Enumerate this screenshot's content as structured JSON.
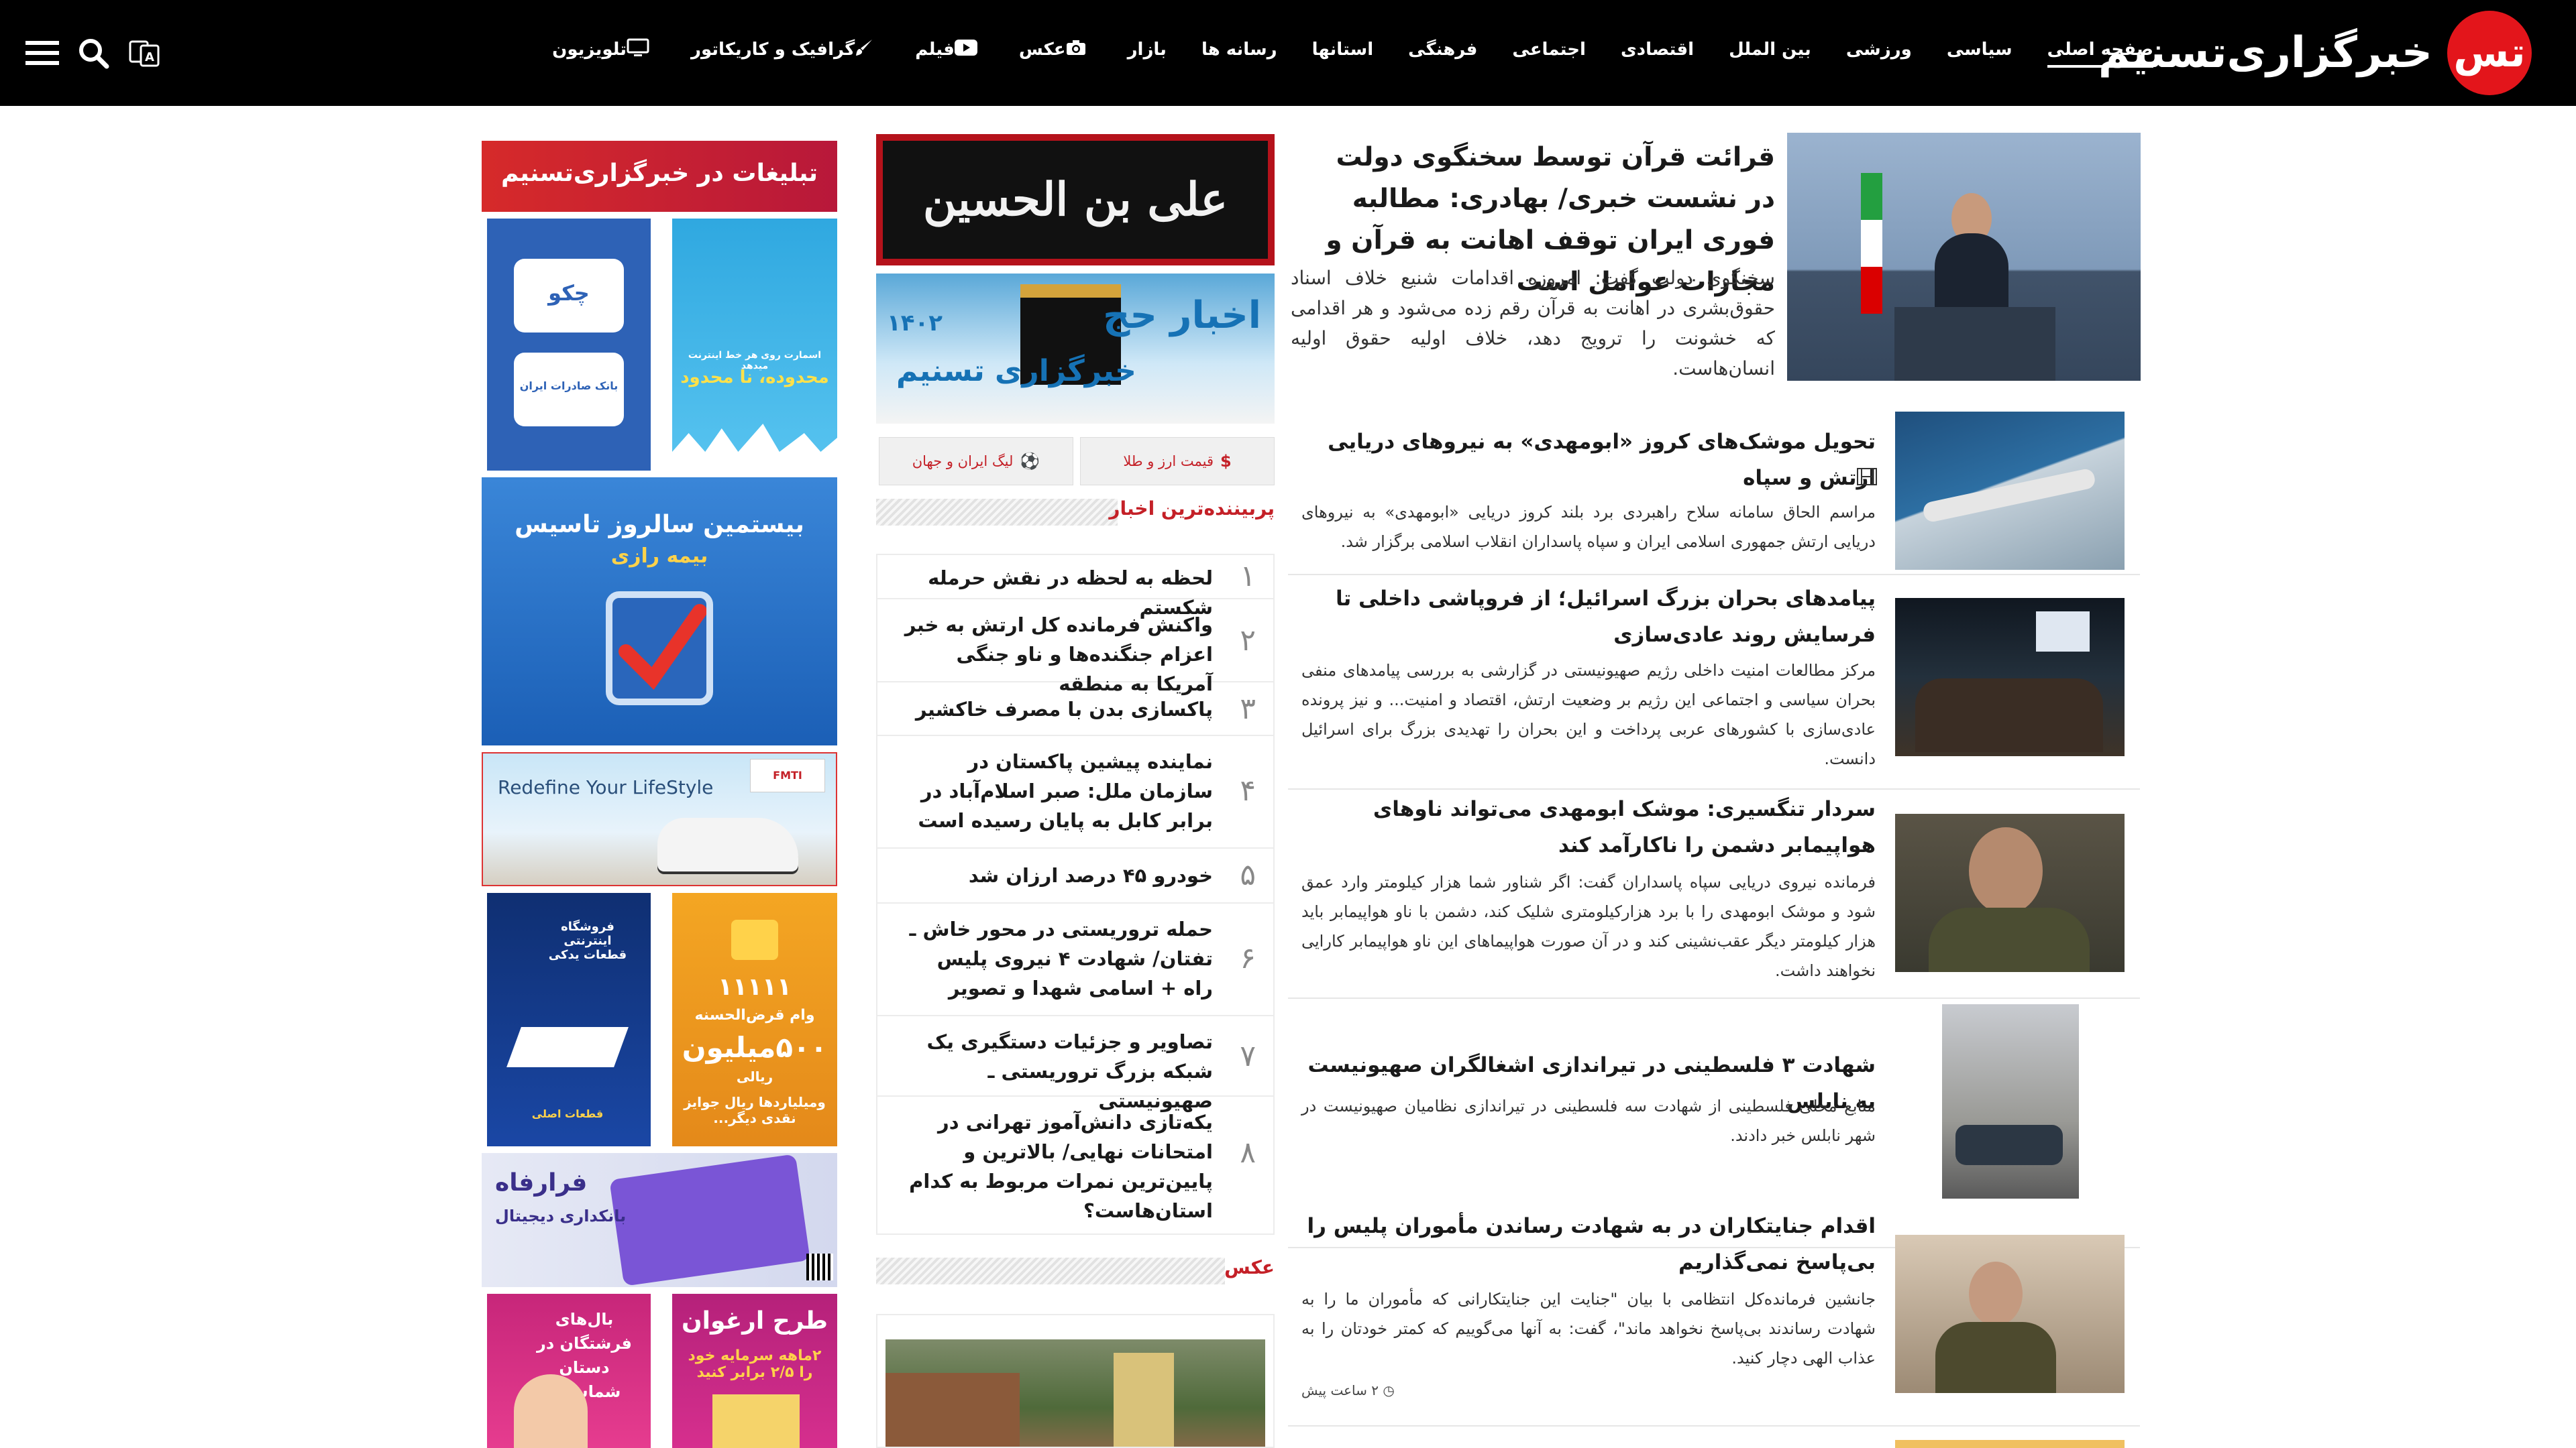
{
  "header": {
    "logo_text": "خبرگزاری‌تسنیم",
    "logo_mark": "تس",
    "nav": [
      {
        "label": "صفحه اصلی",
        "icon": "",
        "active": true
      },
      {
        "label": "سیاسی",
        "icon": ""
      },
      {
        "label": "ورزشی",
        "icon": ""
      },
      {
        "label": "بین الملل",
        "icon": ""
      },
      {
        "label": "اقتصادی",
        "icon": ""
      },
      {
        "label": "اجتماعی",
        "icon": ""
      },
      {
        "label": "فرهنگی",
        "icon": ""
      },
      {
        "label": "استانها",
        "icon": ""
      },
      {
        "label": "رسانه ها",
        "icon": ""
      },
      {
        "label": "بازار",
        "icon": ""
      },
      {
        "label": "عکس",
        "icon": "camera-icon"
      },
      {
        "label": "فیلم",
        "icon": "play-icon"
      },
      {
        "label": "گرافیک و کاریکاتور",
        "icon": "brush-icon"
      },
      {
        "label": "تلویزیون",
        "icon": "tv-icon"
      }
    ],
    "tools": [
      "menu-icon",
      "search-icon",
      "translate-icon"
    ]
  },
  "lead": {
    "title": "قرائت قرآن توسط سخنگوی دولت در نشست خبری/ بهادری: مطالبه فوری ایران توقف اهانت به قرآن و مجازات عوامل است",
    "summary": "سخنگوی دولت گفت: امروزه اقدامات شنیع خلاف اسناد حقوق‌بشری در اهانت به قرآن رقم زده می‌شود و هر اقدامی که خشونت را ترویج دهد، خلاف اولیه حقوق اولیه انسان‌هاست."
  },
  "news": [
    {
      "title": "تحویل موشک‌های کروز «ابومهدی» به نیروهای دریایی ارتش و سپاه",
      "video": true,
      "summary": "مراسم الحاق سامانه سلاح راهبردی برد بلند کروز دریایی «ابومهدی» به نیروهای دریایی ارتش جمهوری اسلامی ایران و سپاه پاسداران انقلاب اسلامی برگزار شد."
    },
    {
      "title": "پیامدهای بحران بزرگ اسرائیل؛ از فروپاشی داخلی تا فرسایش روند عادی‌سازی",
      "summary": "مرکز مطالعات امنیت داخلی رژیم صهیونیستی در گزارشی به بررسی پیامدهای منفی بحران سیاسی و اجتماعی این رژیم بر وضعیت ارتش، اقتصاد و امنیت... و نیز پرونده عادی‌سازی با کشورهای عربی پرداخت و این بحران را تهدیدی بزرگ برای اسرائیل دانست."
    },
    {
      "title": "سردار تنگسیری: موشک ابومهدی می‌تواند ناوهای هواپیمابر دشمن را ناکارآمد کند",
      "summary": "فرمانده نیروی دریایی سپاه پاسداران گفت: اگر شناور شما هزار کیلومتر وارد عمق شود و موشک ابومهدی را با برد هزارکیلومتری شلیک کند، دشمن با ناو هواپیمابر باید هزار کیلومتر دیگر عقب‌نشینی کند و در آن صورت هواپیماهای این ناو هواپیمابر کارایی نخواهند داشت."
    },
    {
      "title": "شهادت ۳ فلسطینی در تیراندازی اشغالگران صهیونیست به نابلس",
      "summary": "منابع محلی فلسطینی از شهادت سه فلسطینی در تیراندازی نظامیان صهیونیست در شهر نابلس خبر دادند."
    },
    {
      "title": "اقدام جنایتکاران در به شهادت رساندن مأموران پلیس را بی‌پاسخ نمی‌گذاریم",
      "summary": "جانشین فرمانده‌کل انتظامی با بیان \"جنایت این جنایتکارانی که مأموران ما را به شهادت رساندند بی‌پاسخ نخواهد ماند\"، گفت: به آنها می‌گوییم که کمتر خودتان را به عذاب الهی دچار کنید.",
      "time": "۲ ساعت پیش"
    }
  ],
  "middle": {
    "muharram_text": "علی بن الحسین",
    "hajj": {
      "title": "اخبار حج",
      "year": "۱۴۰۲",
      "brand": "خبرگزاری تسنیم"
    },
    "buttons": [
      {
        "label": "قیمت ارز و طلا",
        "icon": "dollar-icon"
      },
      {
        "label": "لیگ ایران و جهان",
        "icon": "football-icon"
      }
    ],
    "popular_heading": "پربیننده‌ترین اخبار",
    "popular": [
      {
        "num": "۱",
        "text": "لحظه به لحظه در نقش حرمله شکستم"
      },
      {
        "num": "۲",
        "text": "واکنش فرمانده کل ارتش به خبر اعزام جنگنده‌ها و ناو جنگی آمریکا به منطقه"
      },
      {
        "num": "۳",
        "text": "پاکسازی بدن با مصرف خاکشیر"
      },
      {
        "num": "۴",
        "text": "نماینده پیشین پاکستان در سازمان ملل: صبر اسلام‌آباد در برابر کابل به پایان رسیده است"
      },
      {
        "num": "۵",
        "text": "خودرو ۴۵ درصد ارزان شد"
      },
      {
        "num": "۶",
        "text": "حمله تروریستی در محور خاش ـ تفتان/ شهادت ۴ نیروی پلیس راه + اسامی شهدا و تصویر"
      },
      {
        "num": "۷",
        "text": "تصاویر و جزئیات دستگیری یک شبکه بزرگ تروریستی ـ صهیونیستی"
      },
      {
        "num": "۸",
        "text": "یکه‌تازی دانش‌آموز تهرانی در امتحانات نهایی/ بالاترین و پایین‌ترین نمرات مربوط به کدام استان‌هاست؟"
      }
    ],
    "photo_heading": "عکس"
  },
  "ads": {
    "top": "تبلیغات در خبرگزاری‌تسنیم",
    "chekad": "چکو",
    "bank": "بانک صادرات ایران",
    "internet": "محدوده، نا محدود",
    "internet_small": "اسمارت روی هر خط اینترنت میدهد",
    "insurance": "بیستمین سالروز تاسیس",
    "insurance_brand": "بیمه رازی",
    "car": "Redefine Your LifeStyle",
    "car_brand": "FMTI",
    "store": "فروشگاه اینترنتی قطعات یدکی",
    "store_brand": "قطعات اصلی",
    "loan_code": "۱۱۱۱۱",
    "loan_small": "وام قرض‌الحسنه",
    "loan_amount": "۵۰۰میلیون",
    "loan_extra": "ریالی",
    "loan_more": "ومیلیاردها ریال جوایز نقدی دیگر...",
    "faraf": "فرارفاه",
    "faraf_sub": "بانکداری دیجیتال",
    "kids": "بال‌های فرشتگان در دستان شماست!",
    "arghavan": "طرح ارغوان",
    "arghavan_sub": "۲ماهه سرمایه خود را ۲/۵ برابر کنید"
  },
  "colors": {
    "accent": "#c42027",
    "logo": "#e3151b",
    "topbar": "#000000"
  }
}
